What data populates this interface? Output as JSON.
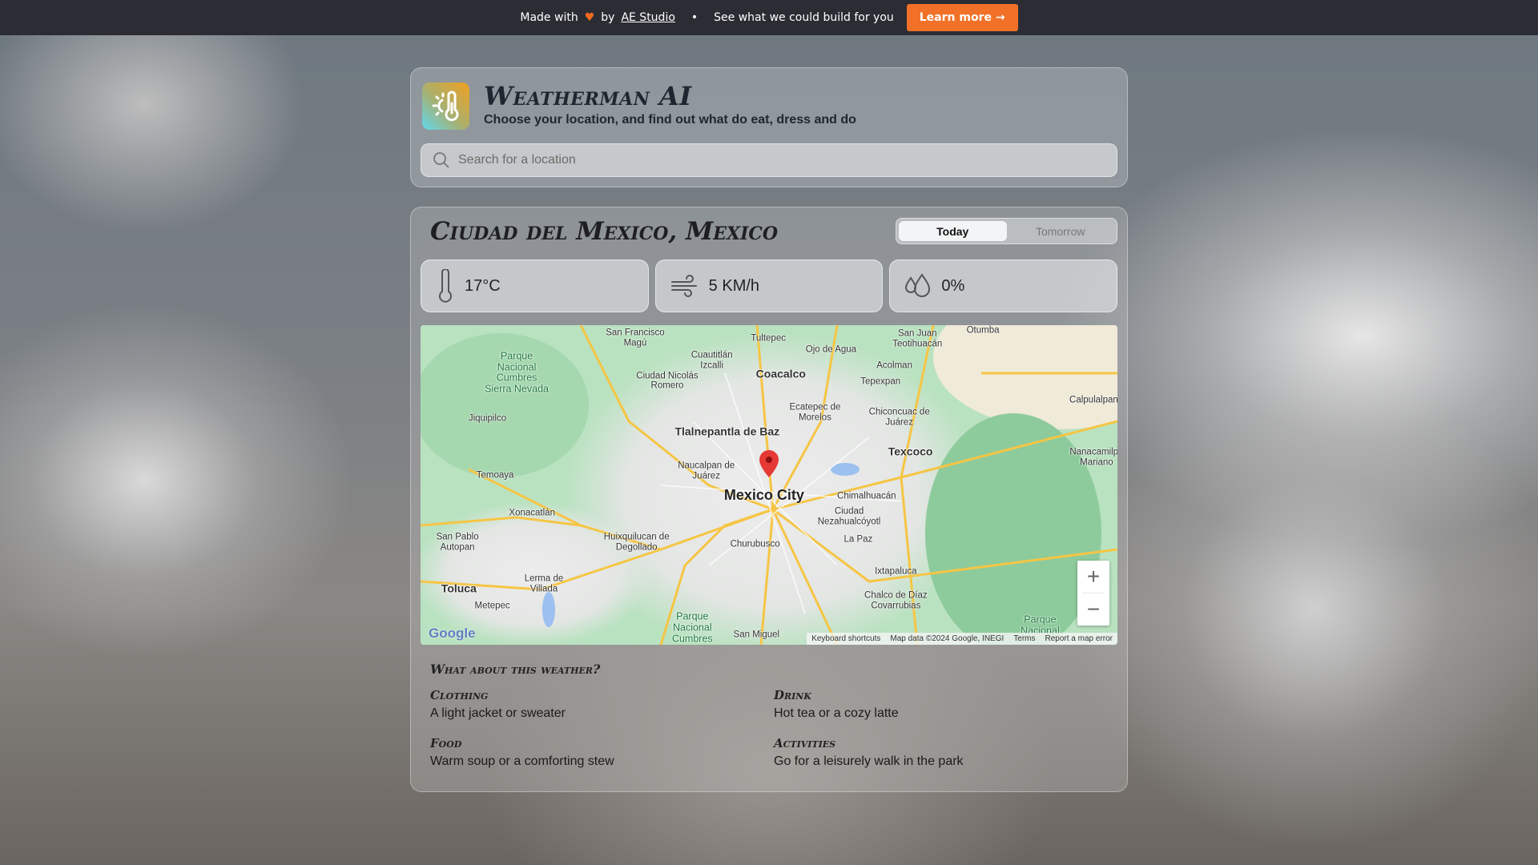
{
  "banner": {
    "made_with": "Made with",
    "by": "by",
    "studio_link": "AE Studio",
    "separator": "•",
    "tagline": "See what we could build for you",
    "cta": "Learn more →"
  },
  "header": {
    "title": "Weatherman AI",
    "subtitle": "Choose your location, and find out what do eat, dress and do",
    "search_placeholder": "Search for a location",
    "search_value": ""
  },
  "weather": {
    "location": "Ciudad del Mexico, Mexico",
    "tabs": [
      {
        "label": "Today",
        "active": true
      },
      {
        "label": "Tomorrow",
        "active": false
      }
    ],
    "temperature": "17°C",
    "wind": "5 KM/h",
    "precipitation": "0%"
  },
  "map": {
    "main_label": "Mexico City",
    "labels": [
      "Tlalnepantla de Baz",
      "Coacalco",
      "Texcoco",
      "Toluca",
      "Naucalpan de Juárez",
      "Chimalhuacán",
      "Ciudad Nezahualcóyotl",
      "Churubusco",
      "La Paz",
      "Ixtapaluca",
      "Chalco de Díaz Covarrubias",
      "Huixquilucan de Degollado",
      "Xonacatlán",
      "Temoaya",
      "Jiquipilco",
      "Ciudad Nicolás Romero",
      "Cuautitlán Izcalli",
      "Tultepec",
      "Ojo de Agua",
      "San Juan Teotihuacán",
      "Otumba",
      "Acolman",
      "Tepexpan",
      "Ecatepec de Morelos",
      "Chiconcuac de Juárez",
      "Calpulalpan",
      "Nanacamilpa Mariano",
      "San Francisco Magú",
      "San Pablo Autopan",
      "Lerma de Villada",
      "Metepec",
      "San Miguel"
    ],
    "parks": [
      "Parque Nacional Cumbres Sierra Nevada",
      "Parque Nacional Cumbres",
      "Parque Nacional"
    ],
    "zoom_in": "+",
    "zoom_out": "−",
    "logo": "Google",
    "attribution": [
      "Keyboard shortcuts",
      "Map data ©2024 Google, INEGI",
      "Terms",
      "Report a map error"
    ]
  },
  "advice": {
    "heading": "What about this weather?",
    "items": [
      {
        "title": "Clothing",
        "text": "A light jacket or sweater"
      },
      {
        "title": "Drink",
        "text": "Hot tea or a cozy latte"
      },
      {
        "title": "Food",
        "text": "Warm soup or a comforting stew"
      },
      {
        "title": "Activities",
        "text": "Go for a leisurely walk in the park"
      }
    ]
  },
  "colors": {
    "accent": "#f07127",
    "banner_bg": "#2b2c34",
    "pin": "#e53935"
  }
}
